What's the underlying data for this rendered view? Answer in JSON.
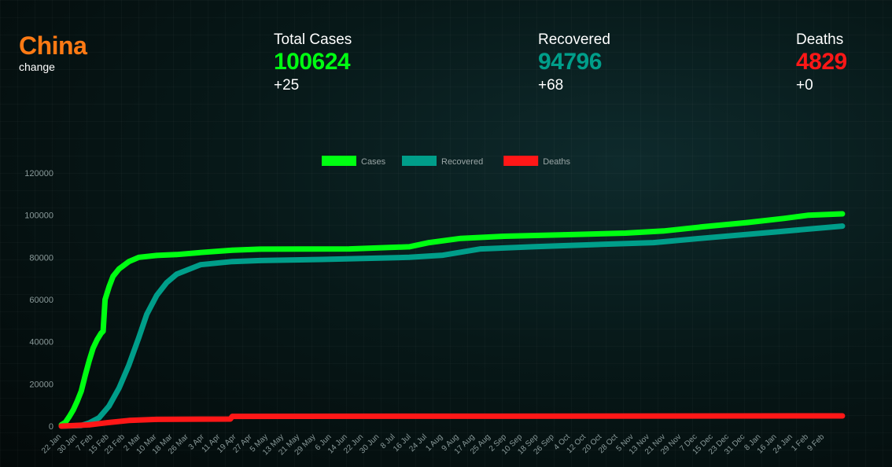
{
  "country": {
    "name": "China",
    "change_label": "change"
  },
  "stats": {
    "total": {
      "label": "Total Cases",
      "value": "100624",
      "delta": "+25",
      "color": "#00ff12"
    },
    "recovered": {
      "label": "Recovered",
      "value": "94796",
      "delta": "+68",
      "color": "#009e8a"
    },
    "deaths": {
      "label": "Deaths",
      "value": "4829",
      "delta": "+0",
      "color": "#ff1717"
    }
  },
  "chart_data": {
    "type": "line",
    "title": "",
    "xlabel": "",
    "ylabel": "",
    "ylim": [
      0,
      120000
    ],
    "yticks": [
      0,
      20000,
      40000,
      60000,
      80000,
      100000,
      120000
    ],
    "xlim": [
      "2020-01-22",
      "2021-02-20"
    ],
    "xticks": [
      "22 Jan",
      "30 Jan",
      "7 Feb",
      "15 Feb",
      "23 Feb",
      "2 Mar",
      "10 Mar",
      "18 Mar",
      "26 Mar",
      "3 Apr",
      "11 Apr",
      "19 Apr",
      "27 Apr",
      "5 May",
      "13 May",
      "21 May",
      "29 May",
      "6 Jun",
      "14 Jun",
      "22 Jun",
      "30 Jun",
      "8 Jul",
      "16 Jul",
      "24 Jul",
      "1 Aug",
      "9 Aug",
      "17 Aug",
      "25 Aug",
      "2 Sep",
      "10 Sep",
      "18 Sep",
      "26 Sep",
      "4 Oct",
      "12 Oct",
      "20 Oct",
      "28 Oct",
      "5 Nov",
      "13 Nov",
      "21 Nov",
      "29 Nov",
      "7 Dec",
      "15 Dec",
      "23 Dec",
      "31 Dec",
      "8 Jan",
      "16 Jan",
      "24 Jan",
      "1 Feb",
      "9 Feb"
    ],
    "legend_position": "top-center",
    "grid": false,
    "series": [
      {
        "name": "Cases",
        "color": "#00ff12",
        "x": [
          "2020-01-22",
          "2020-01-24",
          "2020-01-26",
          "2020-01-28",
          "2020-01-30",
          "2020-02-01",
          "2020-02-03",
          "2020-02-05",
          "2020-02-07",
          "2020-02-09",
          "2020-02-11",
          "2020-02-12",
          "2020-02-13",
          "2020-02-15",
          "2020-02-17",
          "2020-02-20",
          "2020-02-25",
          "2020-03-01",
          "2020-03-10",
          "2020-03-20",
          "2020-04-01",
          "2020-04-17",
          "2020-05-01",
          "2020-06-15",
          "2020-07-15",
          "2020-07-25",
          "2020-08-10",
          "2020-09-01",
          "2020-10-01",
          "2020-11-01",
          "2020-11-20",
          "2020-12-10",
          "2021-01-01",
          "2021-01-20",
          "2021-02-01",
          "2021-02-18"
        ],
        "y": [
          548,
          1800,
          4500,
          7700,
          11800,
          16600,
          24000,
          31000,
          37000,
          41000,
          44000,
          45000,
          60000,
          66000,
          71000,
          74500,
          78000,
          80000,
          80900,
          81300,
          82300,
          83400,
          83900,
          84000,
          85000,
          87000,
          89000,
          90000,
          90700,
          91500,
          92500,
          94500,
          96500,
          98500,
          100000,
          100624
        ]
      },
      {
        "name": "Recovered",
        "color": "#009e8a",
        "x": [
          "2020-01-22",
          "2020-02-01",
          "2020-02-05",
          "2020-02-10",
          "2020-02-15",
          "2020-02-20",
          "2020-02-25",
          "2020-03-01",
          "2020-03-05",
          "2020-03-10",
          "2020-03-15",
          "2020-03-20",
          "2020-04-01",
          "2020-04-17",
          "2020-05-01",
          "2020-06-01",
          "2020-07-15",
          "2020-08-01",
          "2020-08-20",
          "2020-09-15",
          "2020-10-15",
          "2020-11-15",
          "2020-12-15",
          "2021-01-15",
          "2021-02-18"
        ],
        "y": [
          28,
          300,
          1500,
          4000,
          9500,
          18000,
          29000,
          42000,
          53000,
          62000,
          68000,
          72000,
          76500,
          78000,
          78500,
          79000,
          80000,
          81000,
          84000,
          85000,
          86000,
          87000,
          89500,
          92000,
          94796
        ]
      },
      {
        "name": "Deaths",
        "color": "#ff1717",
        "x": [
          "2020-01-22",
          "2020-02-05",
          "2020-02-15",
          "2020-02-25",
          "2020-03-10",
          "2020-04-16",
          "2020-04-17",
          "2021-02-18"
        ],
        "y": [
          17,
          600,
          1700,
          2700,
          3200,
          3350,
          4630,
          4829
        ]
      }
    ]
  }
}
